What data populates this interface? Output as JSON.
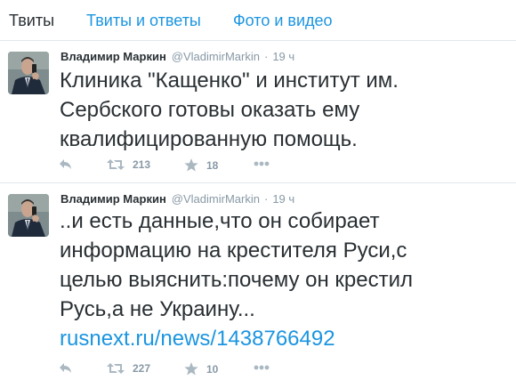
{
  "tabs": [
    {
      "label": "Твиты"
    },
    {
      "label": "Твиты и ответы"
    },
    {
      "label": "Фото и видео"
    }
  ],
  "tweets": [
    {
      "name": "Владимир Маркин",
      "handle": "@VladimirMarkin",
      "separator": "·",
      "time": "19 ч",
      "text": "Клиника \"Кащенко\" и институт им.\nСербского готовы оказать ему\nквалифицированную помощь.",
      "link": "",
      "retweets": "213",
      "favorites": "18"
    },
    {
      "name": "Владимир Маркин",
      "handle": "@VladimirMarkin",
      "separator": "·",
      "time": "19 ч",
      "text": "..и есть данные,что он собирает\nинформацию на крестителя Руси,с\nцелью выяснить:почему он крестил\nРусь,а не Украину...",
      "link": "rusnext.ru/news/1438766492",
      "retweets": "227",
      "favorites": "10"
    }
  ],
  "icons": {
    "reply": "reply-icon",
    "retweet": "retweet-icon",
    "favorite": "star-icon",
    "more": "more-icon"
  },
  "colors": {
    "link": "#1b95e0",
    "text": "#292f33",
    "muted": "#8899a6",
    "icon": "#aab8c2",
    "divider": "#e1e8ed"
  }
}
